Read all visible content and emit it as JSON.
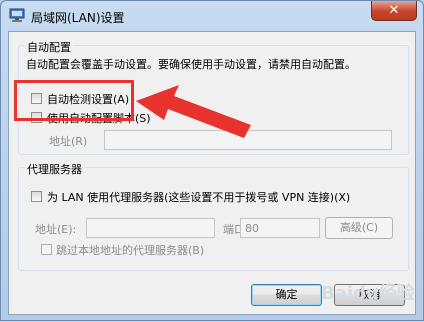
{
  "window": {
    "title": "局域网(LAN)设置",
    "close_glyph": "✕",
    "icon": "lan-settings-icon"
  },
  "auto_config": {
    "legend": "自动配置",
    "description": "自动配置会覆盖手动设置。要确保使用手动设置，请禁用自动配置。",
    "auto_detect_label": "自动检测设置(A)",
    "auto_detect_checked": false,
    "use_script_label": "使用自动配置脚本(S)",
    "use_script_checked": false,
    "address_label": "地址(R)",
    "address_value": ""
  },
  "proxy": {
    "legend": "代理服务器",
    "use_proxy_label": "为 LAN 使用代理服务器(这些设置不用于拨号或 VPN 连接)(X)",
    "use_proxy_checked": false,
    "address_label": "地址(E):",
    "address_value": "",
    "port_label": "端口(T):",
    "port_value": "80",
    "advanced_label": "高级(C)",
    "bypass_label": "跳过本地地址的代理服务器(B)",
    "bypass_checked": false
  },
  "buttons": {
    "ok": "确定",
    "cancel": "取消"
  },
  "annotation": {
    "color": "#e8322d"
  },
  "watermark": "Baidu经验"
}
